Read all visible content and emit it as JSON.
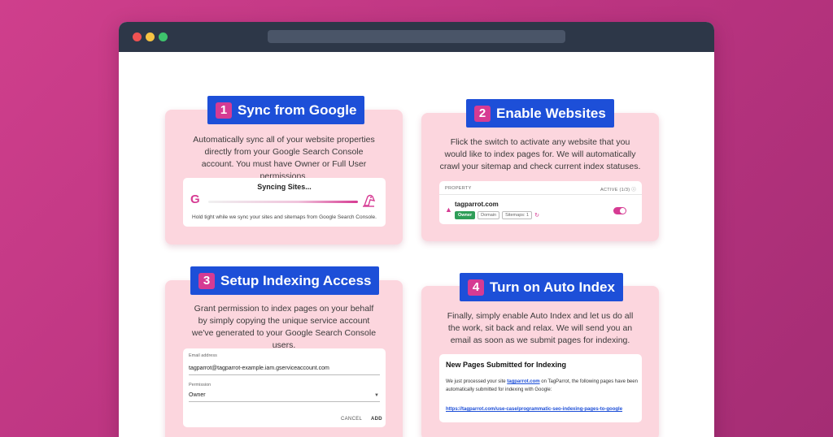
{
  "colors": {
    "accent": "#d63b93",
    "title_bg": "#1d4fd8",
    "card_bg": "#fcd6de"
  },
  "step1": {
    "number": "1",
    "title": "Sync from Google",
    "description": "Automatically sync all of your website properties directly from your Google Search Console account. You must have Owner or Full User permissions.",
    "panel_title": "Syncing Sites...",
    "panel_note": "Hold tight while we sync your sites and sitemaps from Google Search Console."
  },
  "step2": {
    "number": "2",
    "title": "Enable Websites",
    "description": "Flick the switch to activate any website that you would like to index pages for. We will automatically crawl your sitemap and check current index statuses.",
    "column_property": "PROPERTY",
    "column_active": "ACTIVE (1/3)",
    "site": "tagparrot.com",
    "tags": {
      "owner": "Owner",
      "domain": "Domain",
      "sitemaps": "Sitemaps: 1"
    }
  },
  "step3": {
    "number": "3",
    "title": "Setup Indexing Access",
    "description": "Grant permission to index pages on your behalf by simply copying the unique service account we've generated to your Google Search Console users.",
    "email_label": "Email address",
    "email_value": "tagparrot@tagparrot-example.iam.gserviceaccount.com",
    "permission_label": "Permission",
    "permission_value": "Owner",
    "cancel_label": "CANCEL",
    "add_label": "ADD"
  },
  "step4": {
    "number": "4",
    "title": "Turn on Auto Index",
    "description": "Finally, simply enable Auto Index and let us do all the work, sit back and relax. We will send you an email as soon as we submit pages for indexing.",
    "mail_title": "New Pages Submitted for Indexing",
    "mail_text_before": "We just processed your site ",
    "mail_site_link": "tagparrot.com",
    "mail_text_after": " on TagParrot, the following pages have been automatically submitted for indexing with Google:",
    "mail_url": "https://tagparrot.com/use-case/programmatic-seo-indexing-pages-to-google"
  }
}
